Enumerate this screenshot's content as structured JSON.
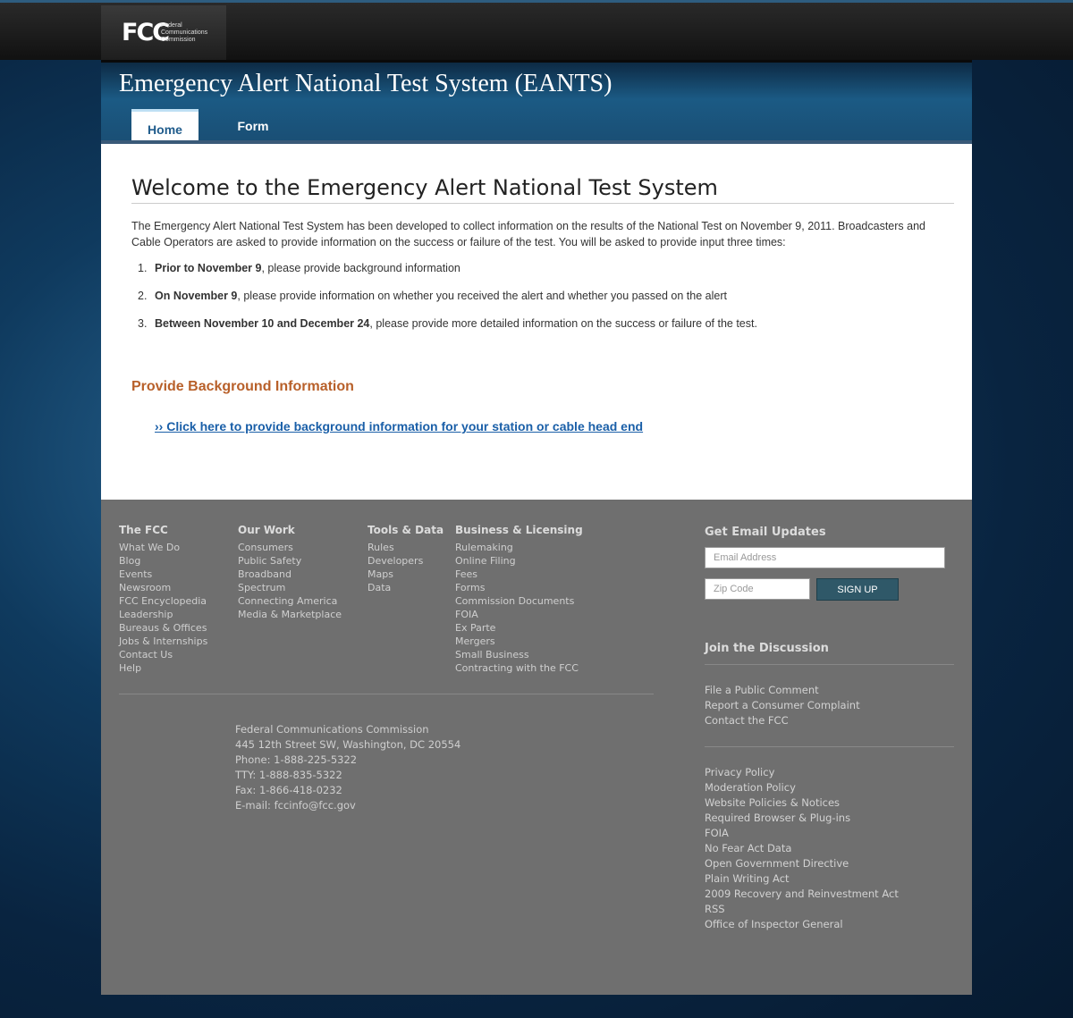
{
  "branding": {
    "logo_mark": "FCC",
    "logo_lines": [
      "Federal",
      "Communications",
      "Commission"
    ]
  },
  "header": {
    "title": "Emergency Alert National Test System (EANTS)",
    "tabs": [
      {
        "label": "Home",
        "active": true
      },
      {
        "label": "Form",
        "active": false
      }
    ]
  },
  "main": {
    "heading": "Welcome to the Emergency Alert National Test System",
    "intro": "The Emergency Alert National Test System has been developed to collect information on the results of the National Test on November 9, 2011. Broadcasters and Cable Operators are asked to provide information on the success or failure of the test. You will be asked to provide input three times:",
    "steps": [
      {
        "num": "1.",
        "bold": "Prior to November 9",
        "text": ", please provide background information"
      },
      {
        "num": "2.",
        "bold": "On November 9",
        "text": ", please provide information on whether you received the alert and whether you passed on the alert"
      },
      {
        "num": "3.",
        "bold": "Between November 10 and December 24",
        "text": ", please provide more detailed information on the success or failure of the test."
      }
    ],
    "section_heading": "Provide Background Information",
    "link": "›› Click here to provide background information for your station or cable head end"
  },
  "footer": {
    "columns": [
      {
        "title": "The FCC",
        "links": [
          "What We Do",
          "Blog",
          "Events",
          "Newsroom",
          "FCC Encyclopedia",
          "Leadership",
          "Bureaus & Offices",
          "Jobs & Internships",
          "Contact Us",
          "Help"
        ]
      },
      {
        "title": "Our Work",
        "links": [
          "Consumers",
          "Public Safety",
          "Broadband",
          "Spectrum",
          "Connecting America",
          "Media & Marketplace"
        ]
      },
      {
        "title": "Tools & Data",
        "links": [
          "Rules",
          "Developers",
          "Maps",
          "Data"
        ]
      },
      {
        "title": "Business & Licensing",
        "links": [
          "Rulemaking",
          "Online Filing",
          "Fees",
          "Forms",
          "Commission Documents",
          "FOIA",
          "Ex Parte",
          "Mergers",
          "Small Business",
          "Contracting with the FCC"
        ]
      }
    ],
    "address": [
      "Federal Communications Commission",
      "445 12th Street SW, Washington, DC 20554",
      "Phone: 1-888-225-5322",
      "TTY: 1-888-835-5322",
      "Fax: 1-866-418-0232",
      "E-mail: fccinfo@fcc.gov"
    ],
    "email_updates": {
      "title": "Get Email Updates",
      "email_placeholder": "Email Address",
      "zip_placeholder": "Zip Code",
      "button": "SIGN UP"
    },
    "discussion": {
      "title": "Join the Discussion",
      "links": [
        "File a Public Comment",
        "Report a Consumer Complaint",
        "Contact the FCC"
      ]
    },
    "policy_links": [
      "Privacy Policy",
      "Moderation Policy",
      "Website Policies & Notices",
      "Required Browser & Plug-ins",
      "FOIA",
      "No Fear Act Data",
      "Open Government Directive",
      "Plain Writing Act",
      "2009 Recovery and Reinvestment Act",
      "RSS",
      "Office of Inspector General"
    ]
  }
}
